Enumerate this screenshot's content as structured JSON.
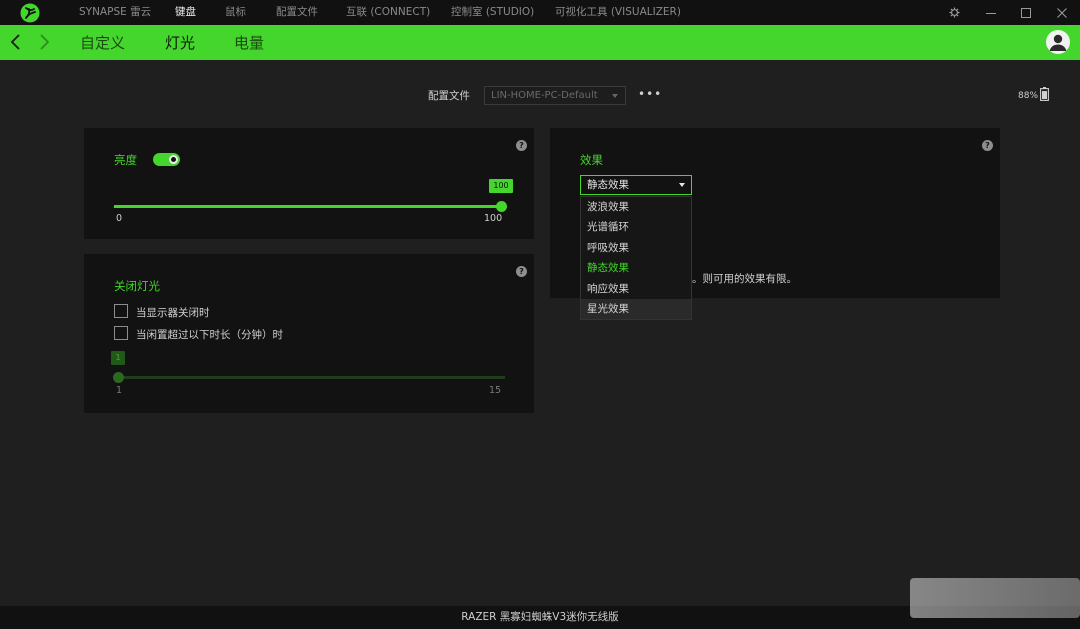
{
  "titlebar": {
    "nav": [
      {
        "label": "SYNAPSE 雷云",
        "active": false
      },
      {
        "label": "键盘",
        "active": true
      },
      {
        "label": "鼠标",
        "active": false
      },
      {
        "label": "配置文件",
        "active": false
      },
      {
        "label": "互联 (CONNECT)",
        "active": false
      },
      {
        "label": "控制室 (STUDIO)",
        "active": false
      },
      {
        "label": "可视化工具 (VISUALIZER)",
        "active": false
      }
    ],
    "icons": [
      "razer-logo-icon",
      "gear-icon",
      "minimize-icon",
      "maximize-icon",
      "close-icon"
    ]
  },
  "subnav": {
    "tabs": [
      {
        "label": "自定义",
        "active": false
      },
      {
        "label": "灯光",
        "active": true
      },
      {
        "label": "电量",
        "active": false
      }
    ]
  },
  "profile": {
    "label": "配置文件",
    "value": "LIN-HOME-PC-Default",
    "more": "•••"
  },
  "battery": {
    "percent_text": "88%",
    "level": 0.88
  },
  "brightness": {
    "title": "亮度",
    "enabled": true,
    "value": 100,
    "value_text": "100",
    "min_text": "0",
    "max_text": "100"
  },
  "lights_off": {
    "title": "关闭灯光",
    "option1": "当显示器关闭时",
    "option2": "当闲置超过以下时长（分钟）时",
    "value": 1,
    "value_text": "1",
    "min_text": "1",
    "max_text": "15"
  },
  "effect": {
    "title": "效果",
    "selected": "静态效果",
    "options": [
      "波浪效果",
      "光谱循环",
      "呼吸效果",
      "静态效果",
      "响应效果",
      "星光效果"
    ],
    "note": "。则可用的效果有限。"
  },
  "footer": {
    "device_name": "RAZER 黑寡妇蜘蛛V3迷你无线版"
  },
  "colors": {
    "accent": "#44d62c",
    "background": "#1f1f1f",
    "panel": "#121212"
  }
}
